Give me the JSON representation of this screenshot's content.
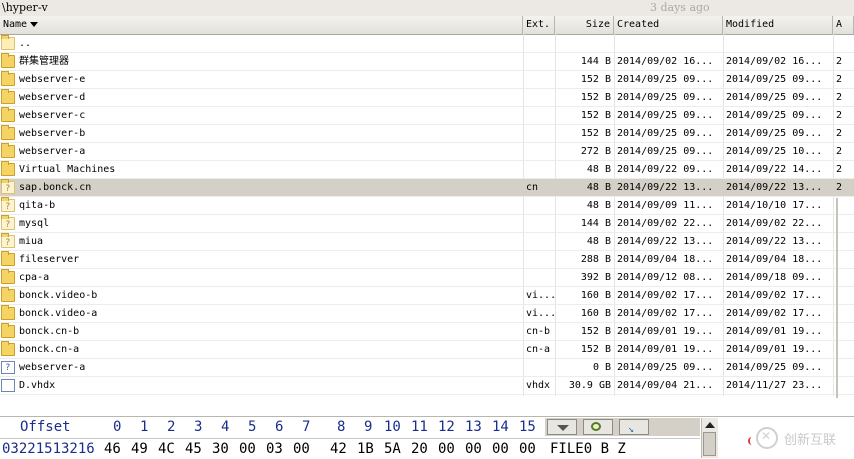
{
  "path": {
    "text": "\\hyper-v",
    "ago": "3 days ago"
  },
  "columns": {
    "name": "Name",
    "ext": "Ext.",
    "size": "Size",
    "created": "Created",
    "modified": "Modified",
    "attr": "A"
  },
  "rows": [
    {
      "icon": "up-folder",
      "name": "..",
      "ext": "",
      "size": "",
      "created": "",
      "modified": "",
      "attr": ""
    },
    {
      "icon": "folder",
      "name": "群集管理器",
      "ext": "",
      "size": "144 B",
      "created": "2014/09/02  16...",
      "modified": "2014/09/02  16...",
      "attr": "2"
    },
    {
      "icon": "folder",
      "name": "webserver-e",
      "ext": "",
      "size": "152 B",
      "created": "2014/09/25  09...",
      "modified": "2014/09/25  09...",
      "attr": "2"
    },
    {
      "icon": "folder",
      "name": "webserver-d",
      "ext": "",
      "size": "152 B",
      "created": "2014/09/25  09...",
      "modified": "2014/09/25  09...",
      "attr": "2"
    },
    {
      "icon": "folder",
      "name": "webserver-c",
      "ext": "",
      "size": "152 B",
      "created": "2014/09/25  09...",
      "modified": "2014/09/25  09...",
      "attr": "2"
    },
    {
      "icon": "folder",
      "name": "webserver-b",
      "ext": "",
      "size": "152 B",
      "created": "2014/09/25  09...",
      "modified": "2014/09/25  09...",
      "attr": "2"
    },
    {
      "icon": "folder",
      "name": "webserver-a",
      "ext": "",
      "size": "272 B",
      "created": "2014/09/25  09...",
      "modified": "2014/09/25  10...",
      "attr": "2"
    },
    {
      "icon": "folder",
      "name": "Virtual Machines",
      "ext": "",
      "size": "48 B",
      "created": "2014/09/22  09...",
      "modified": "2014/09/22  14...",
      "attr": "2"
    },
    {
      "icon": "ghost-folder",
      "name": "sap.bonck.cn",
      "ext": "cn",
      "size": "48 B",
      "created": "2014/09/22  13...",
      "modified": "2014/09/22  13...",
      "attr": "2",
      "selected": true
    },
    {
      "icon": "ghost-folder",
      "name": "qita-b",
      "ext": "",
      "size": "48 B",
      "created": "2014/09/09  11...",
      "modified": "2014/10/10  17...",
      "attr": ""
    },
    {
      "icon": "ghost-folder",
      "name": "mysql",
      "ext": "",
      "size": "144 B",
      "created": "2014/09/02  22...",
      "modified": "2014/09/02  22...",
      "attr": ""
    },
    {
      "icon": "ghost-folder",
      "name": "miua",
      "ext": "",
      "size": "48 B",
      "created": "2014/09/22  13...",
      "modified": "2014/09/22  13...",
      "attr": ""
    },
    {
      "icon": "folder",
      "name": "fileserver",
      "ext": "",
      "size": "288 B",
      "created": "2014/09/04  18...",
      "modified": "2014/09/04  18...",
      "attr": ""
    },
    {
      "icon": "folder",
      "name": "cpa-a",
      "ext": "",
      "size": "392 B",
      "created": "2014/09/12  08...",
      "modified": "2014/09/18  09...",
      "attr": ""
    },
    {
      "icon": "folder",
      "name": "bonck.video-b",
      "ext": "vi...",
      "size": "160 B",
      "created": "2014/09/02  17...",
      "modified": "2014/09/02  17...",
      "attr": ""
    },
    {
      "icon": "folder",
      "name": "bonck.video-a",
      "ext": "vi...",
      "size": "160 B",
      "created": "2014/09/02  17...",
      "modified": "2014/09/02  17...",
      "attr": ""
    },
    {
      "icon": "folder",
      "name": "bonck.cn-b",
      "ext": "cn-b",
      "size": "152 B",
      "created": "2014/09/01  19...",
      "modified": "2014/09/01  19...",
      "attr": ""
    },
    {
      "icon": "folder",
      "name": "bonck.cn-a",
      "ext": "cn-a",
      "size": "152 B",
      "created": "2014/09/01  19...",
      "modified": "2014/09/01  19...",
      "attr": ""
    },
    {
      "icon": "unknown-file",
      "name": "webserver-a",
      "ext": "",
      "size": "0 B",
      "created": "2014/09/25  09...",
      "modified": "2014/09/25  09...",
      "attr": ""
    },
    {
      "icon": "file",
      "name": "D.vhdx",
      "ext": "vhdx",
      "size": "30.9 GB",
      "created": "2014/09/04  21...",
      "modified": "2014/11/27  23...",
      "attr": ""
    }
  ],
  "hex": {
    "offset_label": "Offset",
    "col_headers": [
      "0",
      "1",
      "2",
      "3",
      "4",
      "5",
      "6",
      "7",
      "8",
      "9",
      "10",
      "11",
      "12",
      "13",
      "14",
      "15"
    ],
    "offset": "03221513216",
    "bytes": [
      "46",
      "49",
      "4C",
      "45",
      "30",
      "00",
      "03",
      "00",
      "42",
      "1B",
      "5A",
      "20",
      "00",
      "00",
      "00",
      "00"
    ],
    "text": "FILE0    B Z"
  },
  "watermark": "创新互联"
}
